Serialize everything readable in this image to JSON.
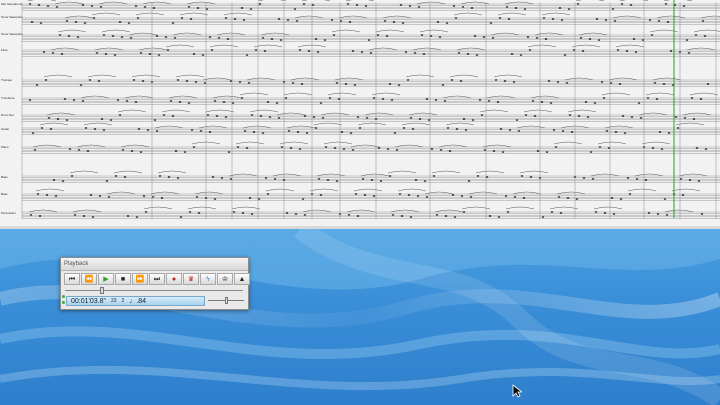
{
  "score": {
    "instruments": [
      "Alto Saxophone",
      "Tenor Saxophone",
      "Flute",
      "Trumpet",
      "Trombone",
      "Drum Set",
      "Guitar",
      "Piano",
      "Bass",
      "Percussion"
    ],
    "playhead_color": "#27a027"
  },
  "playback": {
    "title": "Playback",
    "buttons": [
      {
        "name": "rewind-to-start",
        "glyph": "⏮"
      },
      {
        "name": "rewind",
        "glyph": "⏪"
      },
      {
        "name": "play",
        "glyph": "▶"
      },
      {
        "name": "stop",
        "glyph": "■"
      },
      {
        "name": "fast-forward",
        "glyph": "⏩"
      },
      {
        "name": "fast-forward-to-end",
        "glyph": "⏭"
      },
      {
        "name": "record",
        "glyph": "●"
      },
      {
        "name": "mixer",
        "glyph": "♛"
      },
      {
        "name": "flash",
        "glyph": "ϟ"
      },
      {
        "name": "live-tempo",
        "glyph": "♔"
      },
      {
        "name": "metronome",
        "glyph": "▲"
      }
    ],
    "time": "00:01'03.8\"",
    "bar": "23",
    "beat": "2",
    "tempo": "♩.84",
    "position_fraction": 0.2,
    "tempo_fraction": 0.5
  },
  "desktop": {
    "background_color": "#3a8fd8"
  }
}
